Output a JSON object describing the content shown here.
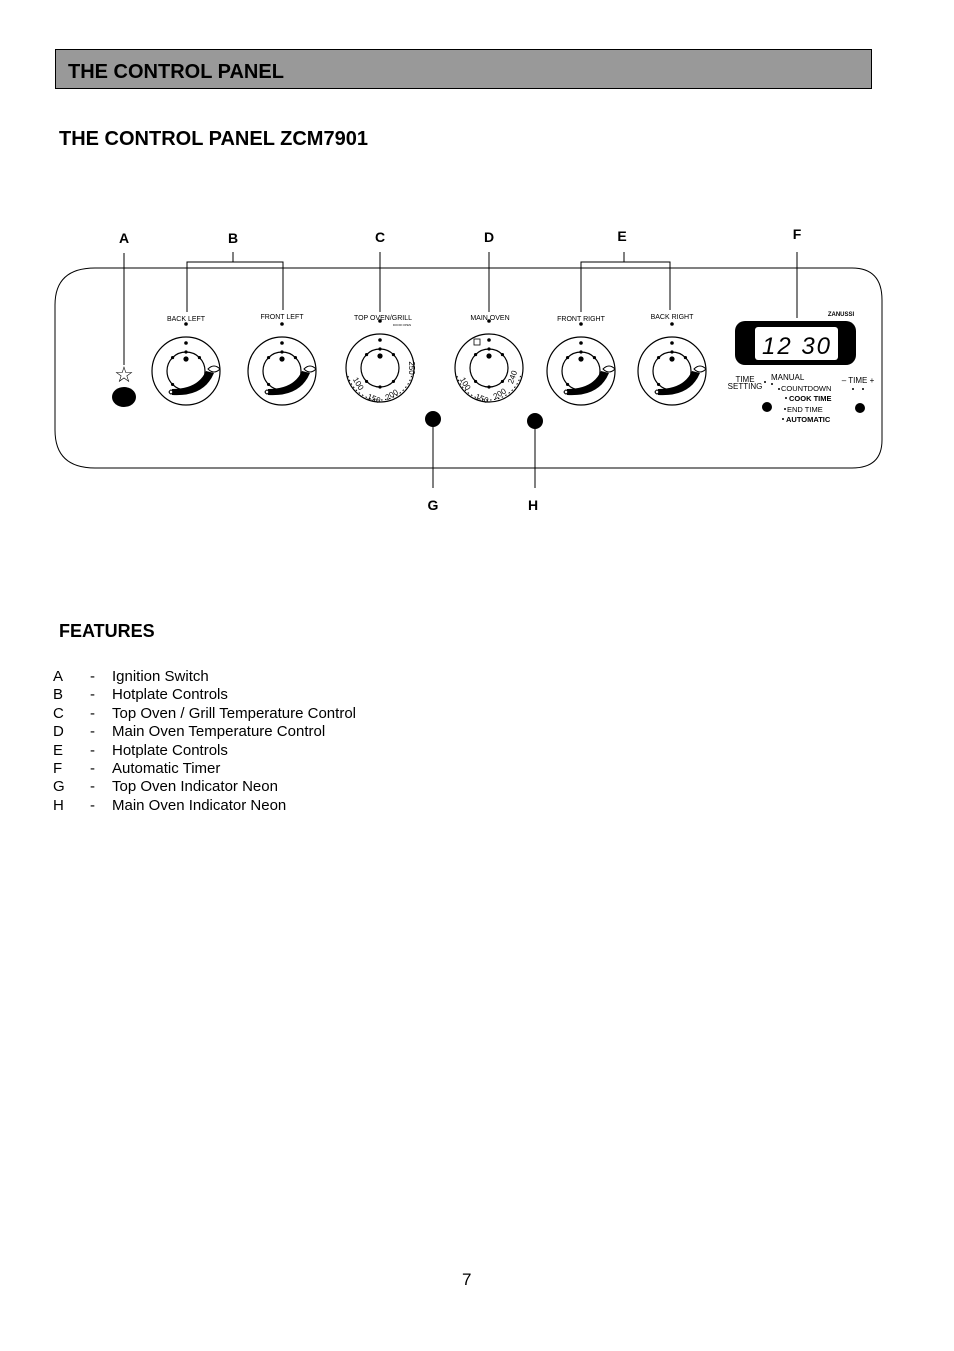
{
  "header": {
    "section_title": "THE CONTROL PANEL"
  },
  "subtitle": "THE CONTROL PANEL ZCM7901",
  "diagram": {
    "callouts": [
      "A",
      "B",
      "C",
      "D",
      "E",
      "F",
      "G",
      "H"
    ],
    "knobs": {
      "back_left": "BACK LEFT",
      "front_left": "FRONT LEFT",
      "top_oven": "TOP OVEN/GRILL",
      "top_oven_sub": "DOOR OPEN",
      "main_oven": "MAIN OVEN",
      "front_right": "FRONT RIGHT",
      "back_right": "BACK RIGHT"
    },
    "top_oven_scale": [
      "100",
      "150",
      "200",
      "250"
    ],
    "main_oven_scale": [
      "100",
      "150",
      "200",
      "240"
    ],
    "brand": "ZANUSSI",
    "timer": {
      "display": "12 30",
      "time_setting": [
        "TIME",
        "SETTING"
      ],
      "modes": [
        "MANUAL",
        "COUNTDOWN",
        "COOK TIME",
        "END TIME",
        "AUTOMATIC"
      ],
      "time_adjust": "– TIME +"
    }
  },
  "features": {
    "title": "FEATURES",
    "items": [
      {
        "letter": "A",
        "desc": "Ignition Switch"
      },
      {
        "letter": "B",
        "desc": "Hotplate Controls"
      },
      {
        "letter": "C",
        "desc": "Top Oven / Grill Temperature Control"
      },
      {
        "letter": "D",
        "desc": "Main Oven Temperature Control"
      },
      {
        "letter": "E",
        "desc": "Hotplate Controls"
      },
      {
        "letter": "F",
        "desc": "Automatic Timer"
      },
      {
        "letter": "G",
        "desc": "Top Oven Indicator Neon"
      },
      {
        "letter": "H",
        "desc": "Main Oven Indicator Neon"
      }
    ]
  },
  "page_number": "7"
}
